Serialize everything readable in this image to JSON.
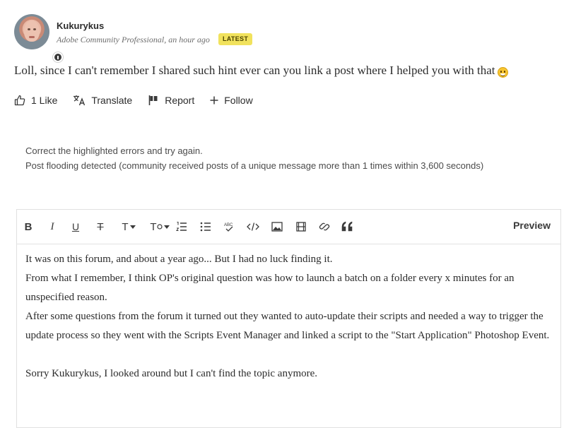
{
  "post": {
    "username": "Kukurykus",
    "role": "Adobe Community Professional",
    "time": ", an hour ago",
    "badge": "LATEST",
    "body": "Loll, since I can't remember I shared such hint ever can you link a post where I helped you with that",
    "emoji_icon": "grinning-emoji-icon"
  },
  "actions": {
    "like": "1 Like",
    "translate": "Translate",
    "report": "Report",
    "follow": "Follow"
  },
  "errors": {
    "line1": "Correct the highlighted errors and try again.",
    "line2": "Post flooding detected (community received posts of a unique message more than 1 times within 3,600 seconds)"
  },
  "editor": {
    "toolbar_icons": [
      "bold-icon",
      "italic-icon",
      "underline-icon",
      "strikethrough-icon",
      "font-size-icon",
      "clear-format-icon",
      "numbered-list-icon",
      "bulleted-list-icon",
      "spellcheck-icon",
      "code-icon",
      "image-icon",
      "video-icon",
      "link-icon",
      "quote-icon"
    ],
    "toolbar_labels": {
      "bold": "B",
      "italic": "I",
      "underline": "U",
      "strikethrough": "T",
      "fontsize": "T",
      "clearformat": "T"
    },
    "preview": "Preview",
    "content": [
      "It was on this forum, and about a year ago... But I had no luck finding it.",
      "From what I remember, I think OP's original question was how to launch a batch on a folder every x minutes for an unspecified reason.",
      "After some questions from the forum it turned out they wanted to auto-update their scripts and needed a way to trigger the update process so they went with the Scripts Event Manager and linked a script to the \"Start Application\" Photoshop Event.",
      "",
      "Sorry Kukurykus, I looked around but I can't find the topic anymore."
    ]
  },
  "colors": {
    "badge_bg": "#f1e25d",
    "text": "#2c2c2c",
    "muted": "#6e6e6e",
    "border": "#e1e1e1"
  }
}
